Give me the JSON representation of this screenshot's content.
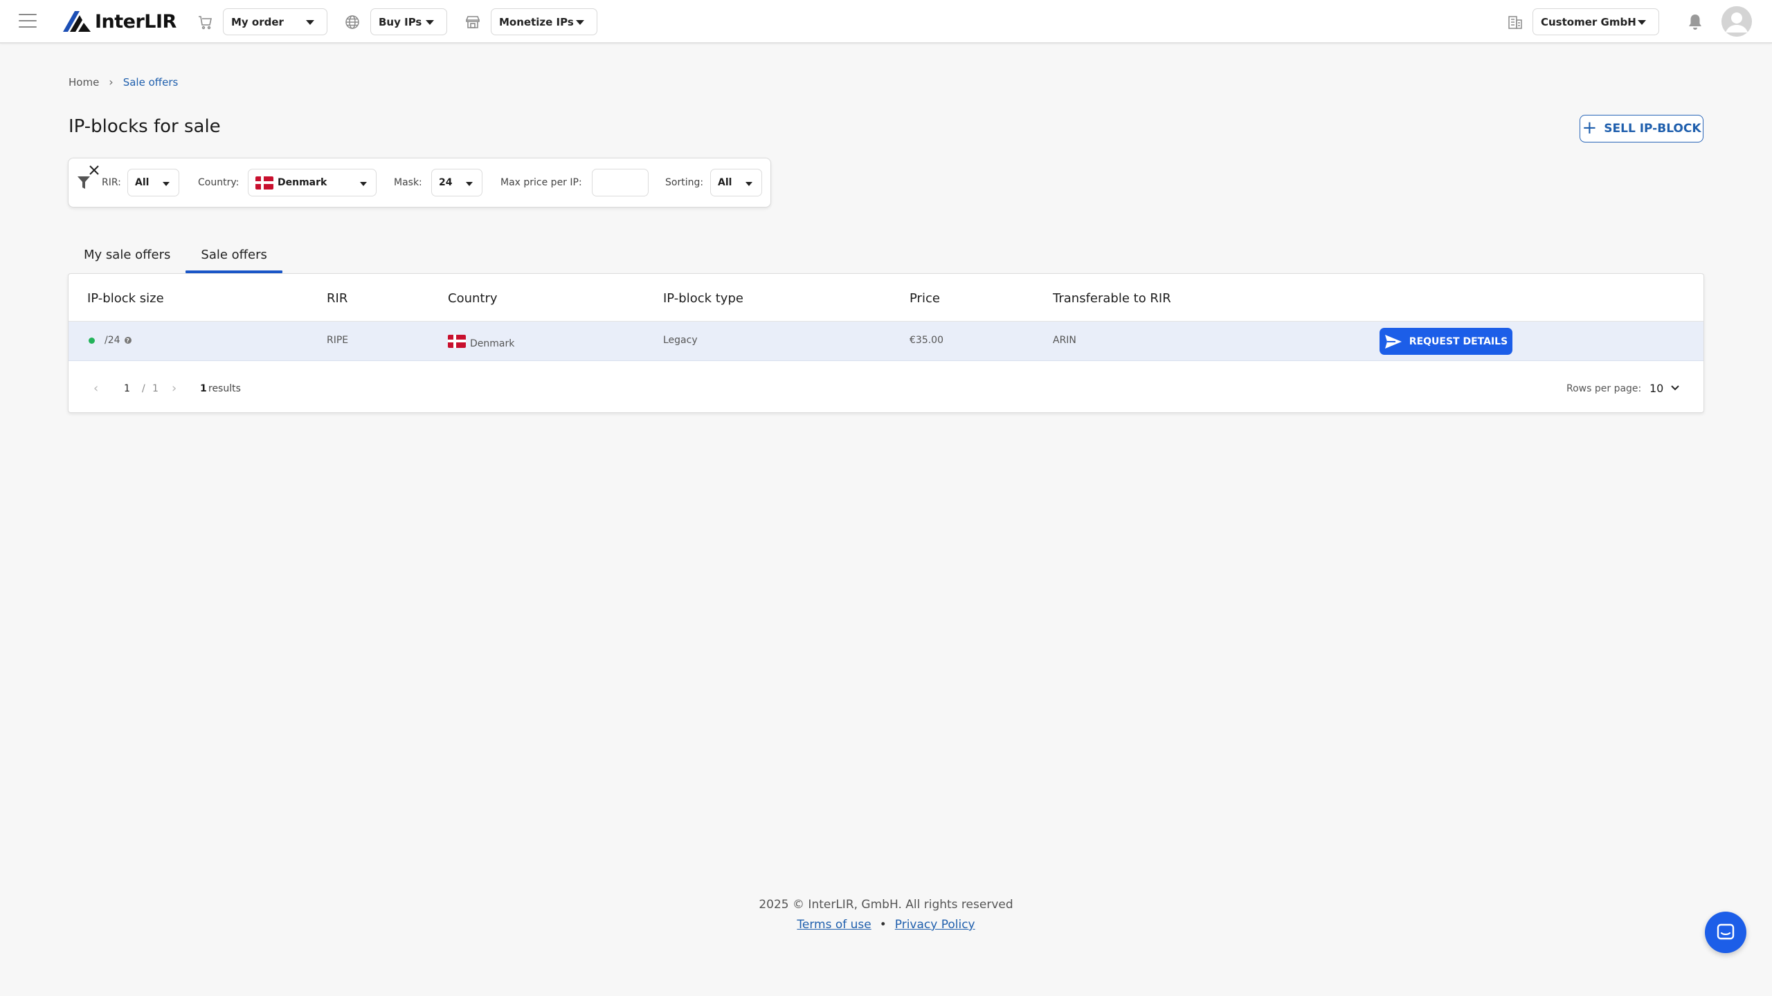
{
  "header": {
    "brand": "InterLIR",
    "nav": [
      {
        "label": "My order"
      },
      {
        "label": "Buy IPs"
      },
      {
        "label": "Monetize IPs"
      }
    ],
    "company": "Customer GmbH"
  },
  "breadcrumb": {
    "home": "Home",
    "separator": "›",
    "current": "Sale offers"
  },
  "page": {
    "title": "IP-blocks for sale",
    "sell_button": "SELL IP-BLOCK"
  },
  "filters": {
    "rir_label": "RIR:",
    "rir_value": "All",
    "country_label": "Country:",
    "country_value": "Denmark",
    "mask_label": "Mask:",
    "mask_value": "24",
    "max_price_label": "Max price per IP:",
    "max_price_value": "",
    "sorting_label": "Sorting:",
    "sorting_value": "All"
  },
  "tabs": [
    {
      "label": "My sale offers",
      "active": false
    },
    {
      "label": "Sale offers",
      "active": true
    }
  ],
  "table": {
    "columns": [
      "IP-block size",
      "RIR",
      "Country",
      "IP-block type",
      "Price",
      "Transferable to RIR"
    ],
    "rows": [
      {
        "size": "/24",
        "rir": "RIPE",
        "country": "Denmark",
        "type": "Legacy",
        "price": "€35.00",
        "transferable": "ARIN",
        "action": "REQUEST DETAILS"
      }
    ]
  },
  "pagination": {
    "current_page": "1",
    "separator": "/",
    "total_pages": "1",
    "results_count": "1",
    "results_label": "results",
    "rows_per_page_label": "Rows per page:",
    "rows_per_page": "10"
  },
  "footer": {
    "copyright": "2025 © InterLIR, GmbH. All rights reserved",
    "terms": "Terms of use",
    "bullet": "•",
    "privacy": "Privacy Policy"
  },
  "colors": {
    "accent": "#1c5ee8",
    "link": "#1f5fad",
    "status_active": "#23b35a",
    "row_highlight": "#e9eef9"
  }
}
